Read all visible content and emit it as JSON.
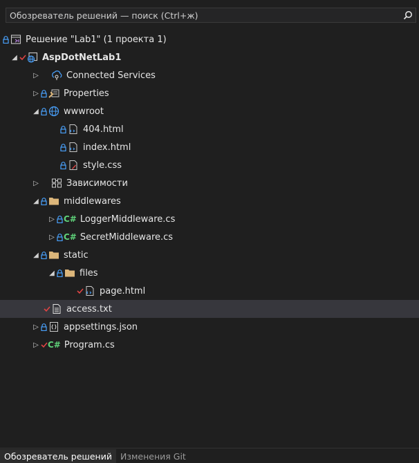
{
  "search": {
    "placeholder": "Обозреватель решений — поиск (Ctrl+ж)"
  },
  "tree": [
    {
      "label": "Решение \"Lab1\"  (1 проекта 1)"
    },
    {
      "label": "AspDotNetLab1"
    },
    {
      "label": "Connected Services"
    },
    {
      "label": "Properties"
    },
    {
      "label": "wwwroot"
    },
    {
      "label": "404.html"
    },
    {
      "label": "index.html"
    },
    {
      "label": "style.css"
    },
    {
      "label": "Зависимости"
    },
    {
      "label": "middlewares"
    },
    {
      "label": "LoggerMiddleware.cs"
    },
    {
      "label": "SecretMiddleware.cs"
    },
    {
      "label": "static"
    },
    {
      "label": "files"
    },
    {
      "label": "page.html"
    },
    {
      "label": "access.txt"
    },
    {
      "label": "appsettings.json"
    },
    {
      "label": "Program.cs"
    }
  ],
  "cs_badge": "C#",
  "tabs": [
    {
      "label": "Обозреватель решений"
    },
    {
      "label": "Изменения Git"
    }
  ]
}
